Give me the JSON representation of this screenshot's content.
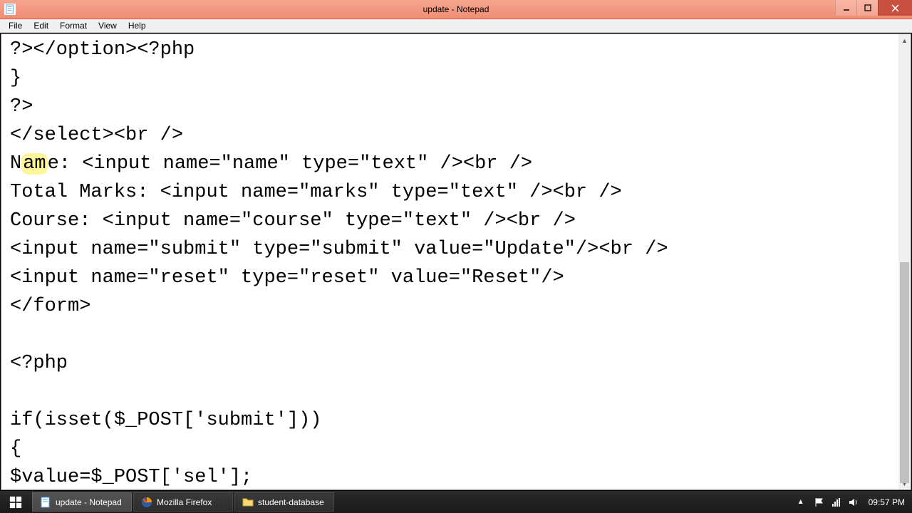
{
  "window": {
    "title": "update - Notepad"
  },
  "menu": {
    "file": "File",
    "edit": "Edit",
    "format": "Format",
    "view": "View",
    "help": "Help"
  },
  "editor": {
    "lines": [
      "?></option><?php",
      "}",
      "?>",
      "</select><br />",
      "Name: <input name=\"name\" type=\"text\" /><br />",
      "Total Marks: <input name=\"marks\" type=\"text\" /><br />",
      "Course: <input name=\"course\" type=\"text\" /><br />",
      "<input name=\"submit\" type=\"submit\" value=\"Update\"/><br />",
      "<input name=\"reset\" type=\"reset\" value=\"Reset\"/>",
      "</form>",
      "",
      "<?php",
      "",
      "if(isset($_POST['submit']))",
      "{",
      "$value=$_POST['sel'];"
    ],
    "highlight_line_index": 4,
    "highlight_text": "am"
  },
  "taskbar": {
    "items": [
      {
        "label": "update - Notepad",
        "icon": "notepad"
      },
      {
        "label": "Mozilla Firefox",
        "icon": "firefox"
      },
      {
        "label": "student-database",
        "icon": "folder"
      }
    ]
  },
  "tray": {
    "time": "09:57 PM"
  }
}
